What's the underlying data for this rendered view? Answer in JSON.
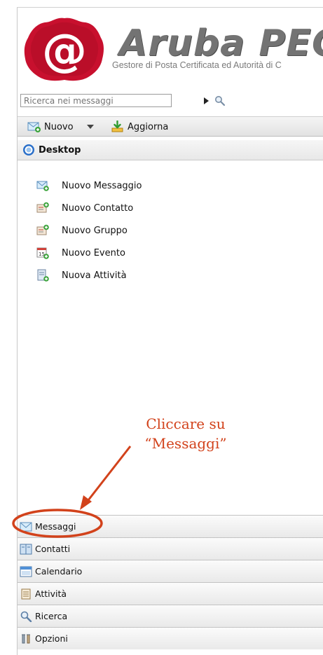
{
  "header": {
    "brand_title": "Aruba PEC",
    "brand_subtitle": "Gestore di Posta Certificata ed Autorità di C"
  },
  "search": {
    "placeholder": "Ricerca nei messaggi"
  },
  "toolbar": {
    "new_label": "Nuovo",
    "refresh_label": "Aggiorna"
  },
  "desktop": {
    "title": "Desktop",
    "items": [
      {
        "label": "Nuovo Messaggio",
        "icon": "new-message-icon"
      },
      {
        "label": "Nuovo Contatto",
        "icon": "new-contact-icon"
      },
      {
        "label": "Nuovo Gruppo",
        "icon": "new-group-icon"
      },
      {
        "label": "Nuovo Evento",
        "icon": "new-event-icon"
      },
      {
        "label": "Nuova Attività",
        "icon": "new-task-icon"
      }
    ]
  },
  "annotation": {
    "line1": "Cliccare su",
    "line2": "“Messaggi”",
    "color": "#d2421b"
  },
  "nav": {
    "items": [
      {
        "label": "Messaggi",
        "icon": "envelope-icon"
      },
      {
        "label": "Contatti",
        "icon": "address-book-icon"
      },
      {
        "label": "Calendario",
        "icon": "calendar-icon"
      },
      {
        "label": "Attività",
        "icon": "task-list-icon"
      },
      {
        "label": "Ricerca",
        "icon": "search-icon"
      },
      {
        "label": "Opzioni",
        "icon": "tools-icon"
      }
    ]
  },
  "colors": {
    "seal_red": "#c8102e",
    "annotation": "#d2421b"
  }
}
